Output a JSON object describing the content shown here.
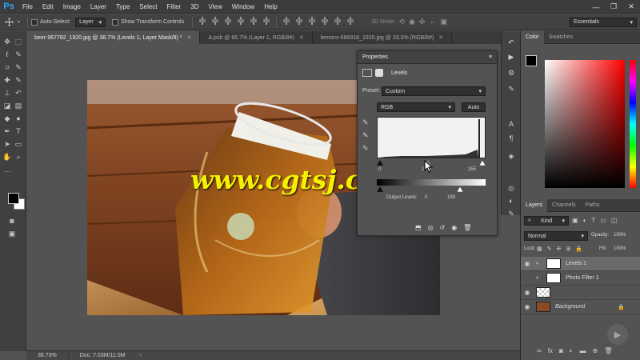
{
  "app": {
    "logo": "Ps"
  },
  "menu": [
    "File",
    "Edit",
    "Image",
    "Layer",
    "Type",
    "Select",
    "Filter",
    "3D",
    "View",
    "Window",
    "Help"
  ],
  "window_controls": [
    "—",
    "❐",
    "✕"
  ],
  "options_bar": {
    "auto_select_label": "Auto-Select:",
    "auto_select_value": "Layer",
    "show_transform_label": "Show Transform Controls",
    "mode_3d_label": "3D Mode:",
    "workspace": "Essentials"
  },
  "tabs": [
    {
      "label": "beer-967782_1920.jpg @ 36.7% (Levels 1, Layer Mask/8) *",
      "active": true
    },
    {
      "label": "A.psb @ 66.7% (Layer 1, RGB/8#)",
      "active": false
    },
    {
      "label": "lemons-686918_1920.jpg @ 33.3% (RGB/8#)",
      "active": false
    }
  ],
  "status": {
    "zoom": "36.73%",
    "doc": "Doc: 7.03M/11.0M"
  },
  "watermark": "www.cgtsj.com",
  "properties": {
    "title": "Properties",
    "adjustment": "Levels",
    "preset_label": "Preset:",
    "preset_value": "Custom",
    "channel": "RGB",
    "auto_label": "Auto",
    "input_black": "0",
    "input_mid": "1.00",
    "input_white": "255",
    "output_label": "Output Levels:",
    "output_black": "0",
    "output_white": "199"
  },
  "color_panel": {
    "tabs": [
      "Color",
      "Swatches"
    ]
  },
  "layers_panel": {
    "tabs": [
      "Layers",
      "Channels",
      "Paths"
    ],
    "filter": "Kind",
    "blend": "Normal",
    "opacity_label": "Opacity:",
    "opacity": "100%",
    "lock_label": "Lock:",
    "fill_label": "Fill:",
    "fill": "100%",
    "layers": [
      {
        "name": "Levels 1",
        "visible": true,
        "selected": true
      },
      {
        "name": "Photo Filter 1",
        "visible": false,
        "selected": false
      },
      {
        "name": "",
        "visible": true,
        "selected": false
      },
      {
        "name": "Background",
        "visible": true,
        "selected": false
      }
    ]
  },
  "colors": {
    "accent": "#31a8ff",
    "panel": "#535353",
    "dark": "#3c3c3c",
    "selected_row": "#6a6a6a",
    "watermark": "#f5f000"
  }
}
